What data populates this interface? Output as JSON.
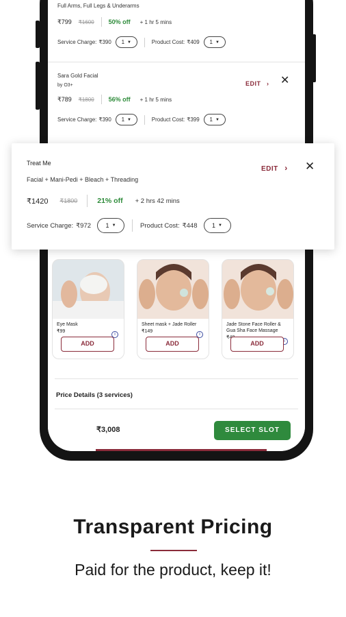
{
  "cart": {
    "items": [
      {
        "name": "Full Arms, Full Legs & Underarms",
        "price": "₹799",
        "original_price": "₹1600",
        "discount": "50% off",
        "duration": "+ 1 hr 5 mins",
        "service_charge_label": "Service Charge:",
        "service_charge": "₹390",
        "service_qty": "1",
        "product_cost_label": "Product Cost:",
        "product_cost": "₹409",
        "product_qty": "1"
      },
      {
        "name": "Sara Gold Facial",
        "brand": "by O3+",
        "price": "₹789",
        "original_price": "₹1800",
        "discount": "56% off",
        "duration": "+ 1 hr 5 mins",
        "edit_label": "EDIT",
        "service_charge_label": "Service Charge:",
        "service_charge": "₹390",
        "service_qty": "1",
        "product_cost_label": "Product Cost:",
        "product_cost": "₹399",
        "product_qty": "1"
      }
    ]
  },
  "popup": {
    "name": "Treat Me",
    "services": "Facial + Mani-Pedi + Bleach + Threading",
    "price": "₹1420",
    "original_price": "₹1800",
    "discount": "21% off",
    "duration": "+ 2 hrs 42 mins",
    "edit_label": "EDIT",
    "service_charge_label": "Service Charge:",
    "service_charge": "₹972",
    "service_qty": "1",
    "product_cost_label": "Product Cost:",
    "product_cost": "₹448",
    "product_qty": "1"
  },
  "addons": [
    {
      "name": "Eye Mask",
      "price": "₹99",
      "add_label": "ADD"
    },
    {
      "name": "Sheet mask + Jade Roller",
      "price": "₹149",
      "add_label": "ADD"
    },
    {
      "name": "Jade Stone Face Roller & Gua Sha Face Massage",
      "price": "₹48",
      "add_label": "ADD"
    }
  ],
  "price_details": {
    "title": "Price Details (3 services)"
  },
  "footer": {
    "total": "₹3,008",
    "cta_label": "SELECT SLOT"
  },
  "caption": {
    "headline": "Transparent Pricing",
    "subline": "Paid for the product, keep it!"
  },
  "colors": {
    "accent": "#8a2b3a",
    "green": "#2f8a3d",
    "discount": "#2e8b3a"
  }
}
